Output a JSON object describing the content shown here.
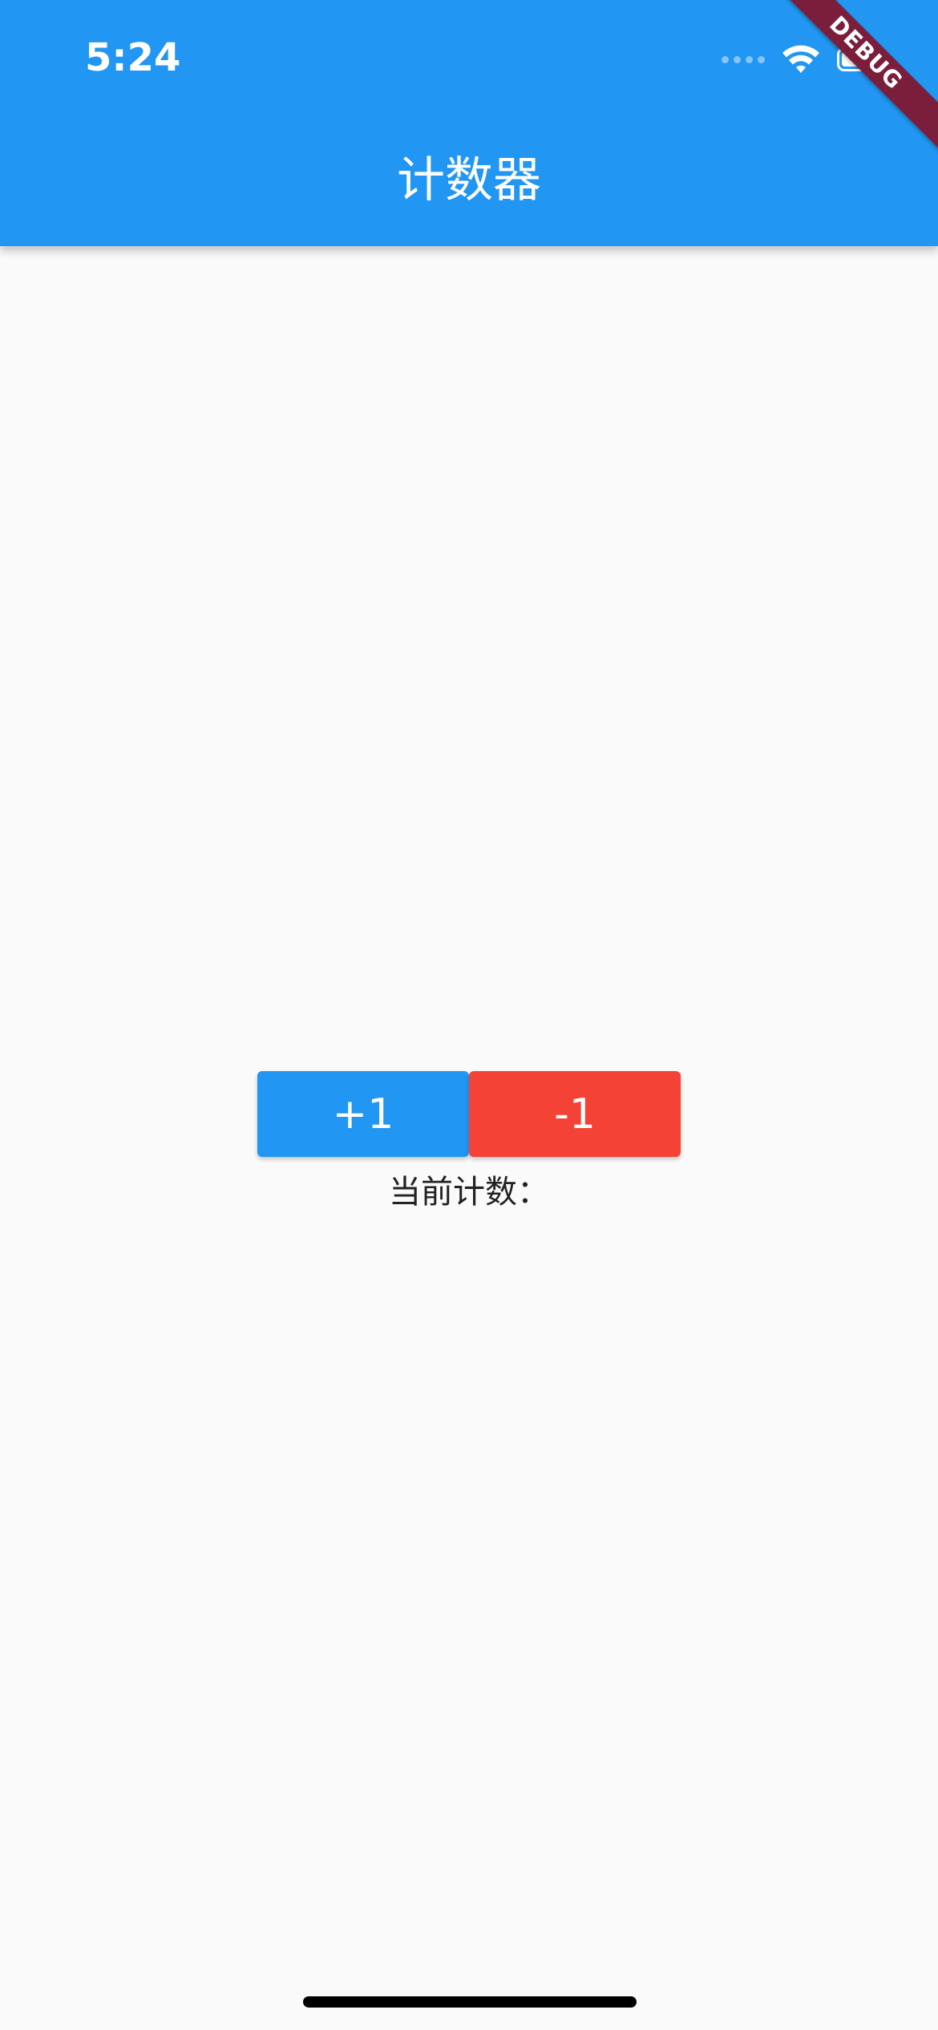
{
  "status_bar": {
    "time": "5:24",
    "icons": [
      "signal-dots-icon",
      "wifi-icon",
      "battery-icon"
    ]
  },
  "app_bar": {
    "title": "计数器",
    "color": "#2196f3"
  },
  "debug_banner": {
    "label": "DEBUG",
    "color": "#7b1e3c"
  },
  "counter": {
    "increment_label": "+1",
    "decrement_label": "-1",
    "increment_color": "#2196f3",
    "decrement_color": "#f44336",
    "count_label": "当前计数：",
    "count_value": ""
  }
}
